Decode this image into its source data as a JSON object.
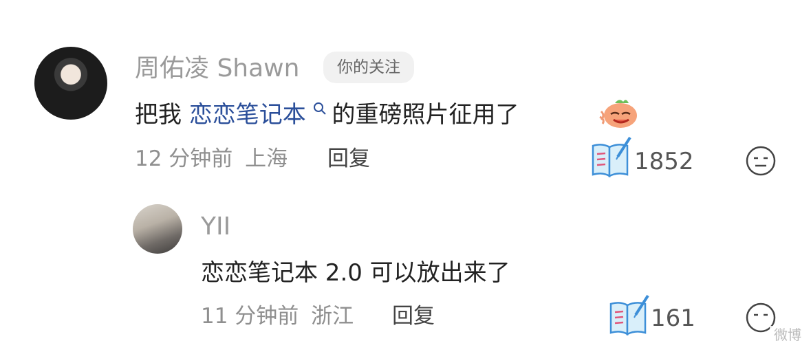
{
  "comment": {
    "username": "周佑凌 Shawn",
    "tag": "你的关注",
    "text_before": "把我 ",
    "keyword": "恋恋笔记本",
    "text_after": " 的重磅照片征用了",
    "time": "12 分钟前",
    "location": "上海",
    "reply_label": "回复",
    "likes": "1852"
  },
  "reply_comment": {
    "username": "YII",
    "text": "恋恋笔记本 2.0 可以放出来了",
    "time": "11 分钟前",
    "location": "浙江",
    "reply_label": "回复",
    "likes": "161"
  },
  "watermark": "微博"
}
